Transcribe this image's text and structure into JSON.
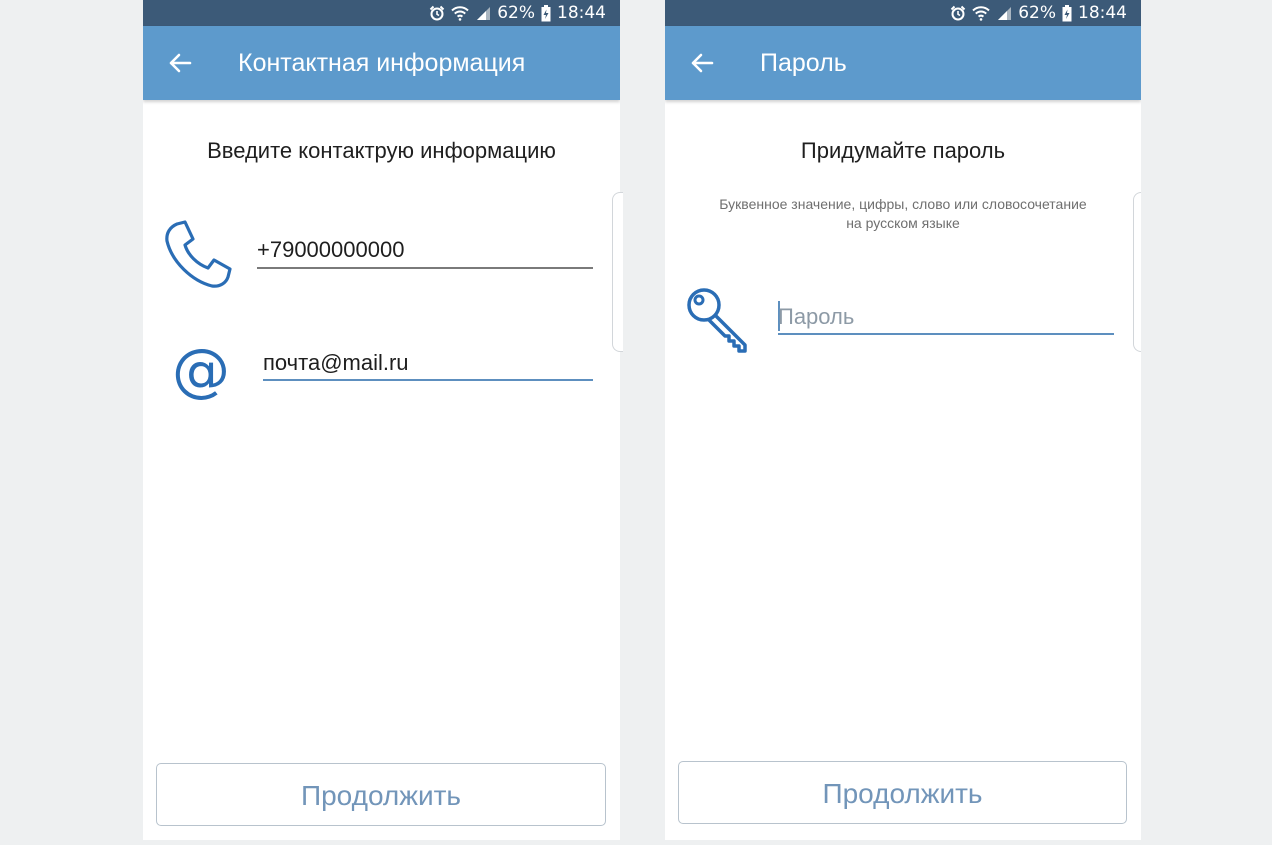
{
  "status_bar": {
    "battery": "62%",
    "time": "18:44",
    "icons": [
      "alarm-icon",
      "wifi-icon",
      "signal-icon",
      "battery-icon"
    ]
  },
  "colors": {
    "app_bar": "#5d9acc",
    "status_bar": "#3c5a78",
    "icon_blue": "#2a6db5",
    "button_text": "#7295b9"
  },
  "screens": {
    "contact": {
      "title": "Контактная информация",
      "heading": "Введите контактрую информацию",
      "phone_value": "+79000000000",
      "email_value": "почта@mail.ru",
      "continue_label": "Продолжить",
      "icons": [
        "back-arrow-icon",
        "phone-icon",
        "at-sign-icon"
      ]
    },
    "password": {
      "title": "Пароль",
      "heading": "Придумайте пароль",
      "hint_line1": "Буквенное значение, цифры, слово или словосочетание",
      "hint_line2": "на русском языке",
      "password_placeholder": "Пароль",
      "continue_label": "Продолжить",
      "icons": [
        "back-arrow-icon",
        "key-icon"
      ]
    }
  }
}
